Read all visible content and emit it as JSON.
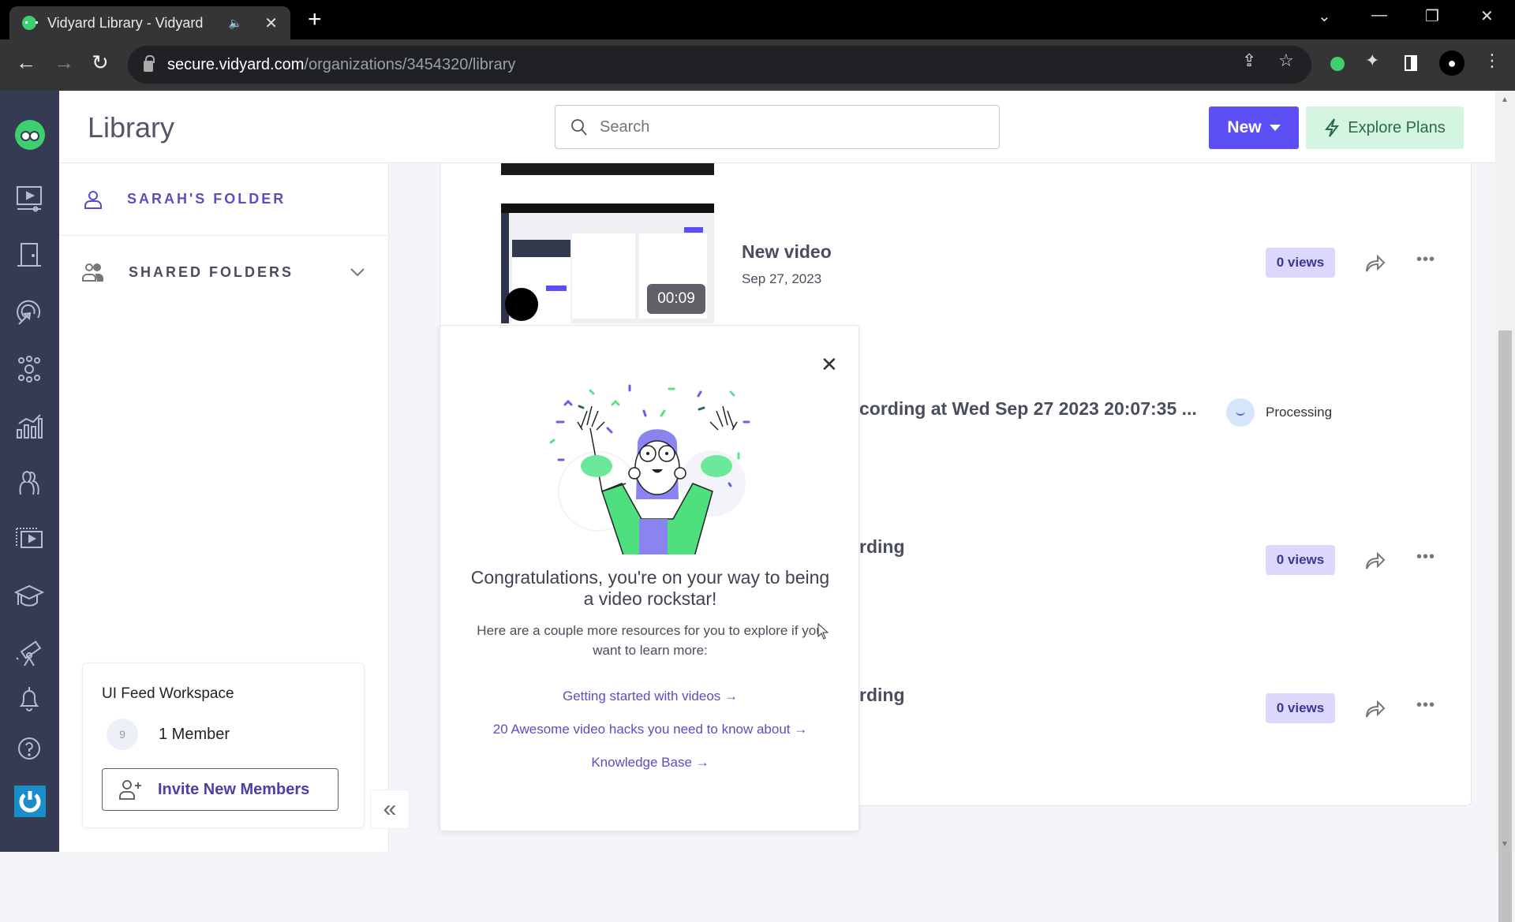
{
  "browser": {
    "tab_title": "Vidyard Library - Vidyard",
    "url_host": "secure.vidyard.com",
    "url_path": "/organizations/3454320/library"
  },
  "header": {
    "title": "Library",
    "search_placeholder": "Search",
    "new_label": "New",
    "explore_label": "Explore Plans"
  },
  "rail": {
    "items": [
      "videos",
      "rooms",
      "campaigns",
      "integrations",
      "analytics",
      "team",
      "playlists",
      "training",
      "explore",
      "notifications",
      "help",
      "account"
    ]
  },
  "folders": {
    "my_folder": "SARAH'S FOLDER",
    "shared": "SHARED FOLDERS"
  },
  "workspace": {
    "name": "UI Feed Workspace",
    "avatar_initial": "9",
    "members": "1 Member",
    "invite_label": "Invite New Members"
  },
  "videos": [
    {
      "title": "New video",
      "date": "Sep 27, 2023",
      "duration": "00:09",
      "views": "0 views"
    },
    {
      "title": "cording at Wed Sep 27 2023 20:07:35 ...",
      "status": "Processing"
    },
    {
      "title": "rding",
      "views": "0 views"
    },
    {
      "title": "rding",
      "views": "0 views"
    }
  ],
  "modal": {
    "heading": "Congratulations, you're on your way to being a video rockstar!",
    "subtext": "Here are a couple more resources for you to explore if you want to learn more:",
    "links": [
      "Getting started with videos →",
      "20 Awesome video hacks you need to know about →",
      "Knowledge Base →"
    ]
  },
  "colors": {
    "brand_purple": "#5b4ff5",
    "brand_green": "#3ecf6e",
    "rail_bg": "#343b52",
    "views_badge": "#dcd8fc"
  }
}
